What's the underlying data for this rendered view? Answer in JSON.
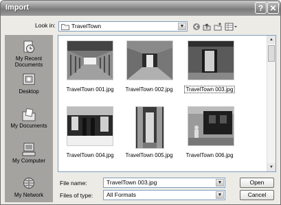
{
  "window": {
    "title": "Import",
    "help_label": "?",
    "close_label": "✕"
  },
  "toolbar": {
    "look_in_label": "Look in:",
    "look_in_value": "TravelTown",
    "icons": [
      "back-icon",
      "up-folder-icon",
      "new-folder-icon",
      "views-menu-icon"
    ]
  },
  "places": [
    {
      "label": "My Recent Documents",
      "icon": "recent-documents-icon"
    },
    {
      "label": "Desktop",
      "icon": "desktop-icon"
    },
    {
      "label": "My Documents",
      "icon": "my-documents-icon"
    },
    {
      "label": "My Computer",
      "icon": "my-computer-icon"
    },
    {
      "label": "My Network",
      "icon": "my-network-icon"
    }
  ],
  "files": [
    {
      "name": "TravelTown 001.jpg",
      "selected": false
    },
    {
      "name": "TravelTown 002.jpg",
      "selected": false
    },
    {
      "name": "TravelTown 003.jpg",
      "selected": true
    },
    {
      "name": "TravelTown 004.jpg",
      "selected": false
    },
    {
      "name": "TravelTown 005.jpg",
      "selected": false
    },
    {
      "name": "TravelTown 006.jpg",
      "selected": false
    }
  ],
  "form": {
    "file_name_label": "File name:",
    "file_name_value": "TravelTown 003.jpg",
    "file_type_label": "Files of type:",
    "file_type_value": "All Formats",
    "open_label": "Open",
    "cancel_label": "Cancel"
  }
}
